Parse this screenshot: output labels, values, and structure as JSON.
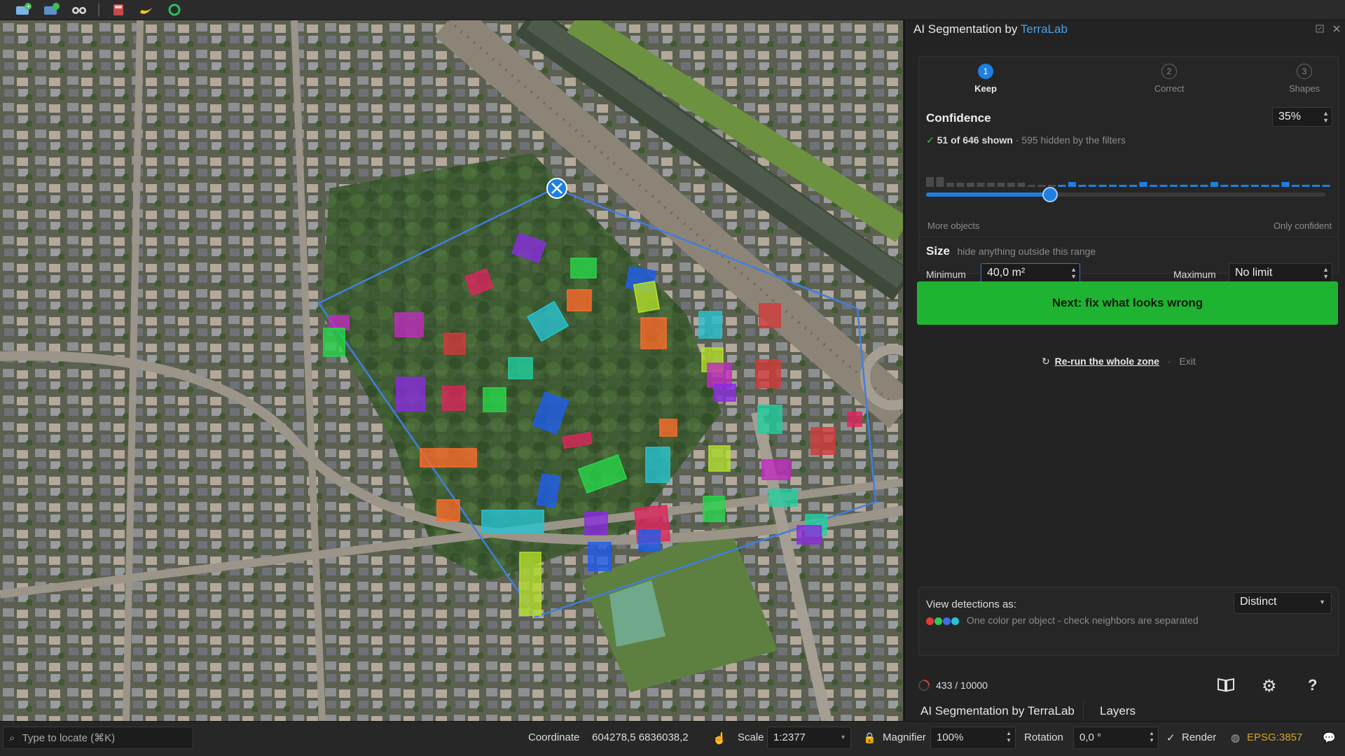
{
  "toolbar": {
    "buttons": [
      "add-layer-icon",
      "add-database-icon",
      "binoculars-icon",
      "calculator-icon",
      "banana-icon",
      "refresh-icon"
    ]
  },
  "panel": {
    "title_prefix": "AI Segmentation by ",
    "title_brand": "TerraLab",
    "steps": [
      {
        "num": "1",
        "label": "Keep"
      },
      {
        "num": "2",
        "label": "Correct"
      },
      {
        "num": "3",
        "label": "Shapes"
      }
    ],
    "confidence": {
      "heading": "Confidence",
      "value": "35%",
      "level": 0.31,
      "shown_text": "51 of 646 shown",
      "hidden_text": "· 595 hidden by the filters",
      "left_label": "More objects",
      "right_label": "Only confident"
    },
    "size": {
      "heading": "Size",
      "hint": "hide anything outside this range",
      "min_label": "Minimum",
      "min_value": "40,0 m²",
      "max_label": "Maximum",
      "max_value": "No limit"
    },
    "next_button": "Next: fix what looks wrong",
    "rerun_link": "Re-run the whole zone",
    "exit_link": "Exit",
    "view": {
      "label": "View detections as:",
      "select_value": "Distinct",
      "description": "One color per object - check neighbors are separated",
      "dot_colors": [
        "#e23a3a",
        "#34c759",
        "#3f6cf0",
        "#27c4d4"
      ]
    },
    "progress": "433 / 10000",
    "tabs": [
      "AI Segmentation by TerraLab",
      "Layers"
    ]
  },
  "statusbar": {
    "locate_placeholder": "Type to locate (⌘K)",
    "coordinate_label": "Coordinate",
    "coordinate_value": "604278,5  6836038,2",
    "scale_label": "Scale",
    "scale_value": "1:2377",
    "magnifier_label": "Magnifier",
    "magnifier_value": "100%",
    "rotation_label": "Rotation",
    "rotation_value": "0,0 °",
    "render_label": "Render",
    "crs": "EPSG:3857"
  },
  "colors": {
    "accent": "#1f7fe0",
    "next_green": "#1eb431",
    "brand": "#4a9ee8"
  }
}
